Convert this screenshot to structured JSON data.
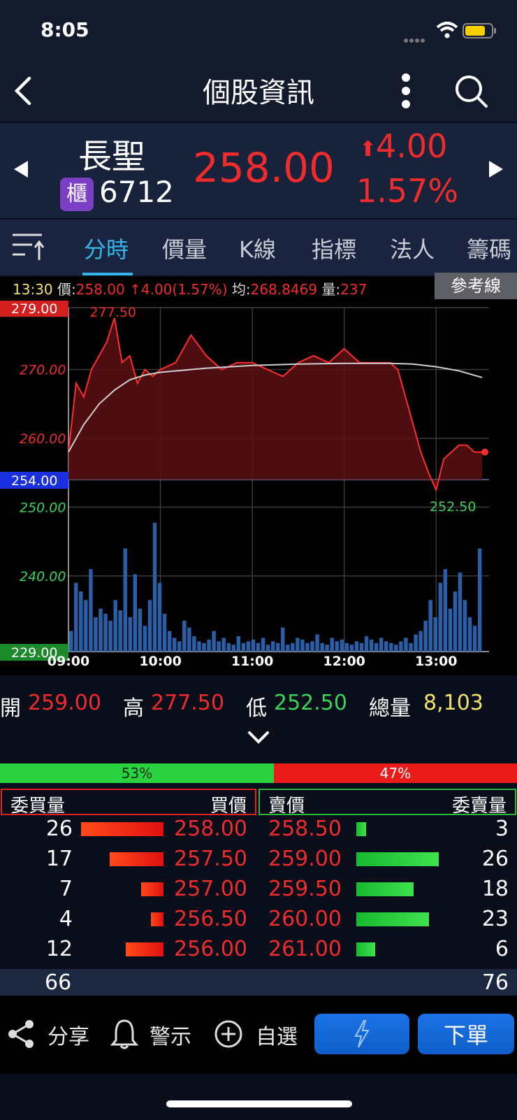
{
  "status": {
    "time": "8:05"
  },
  "header": {
    "title": "個股資訊"
  },
  "stock": {
    "name": "長聖",
    "market_badge": "櫃",
    "code": "6712",
    "price": "258.00",
    "change": "4.00",
    "change_pct": "1.57%"
  },
  "tabs": [
    {
      "label": "分時",
      "active": true
    },
    {
      "label": "價量",
      "active": false
    },
    {
      "label": "K線",
      "active": false
    },
    {
      "label": "指標",
      "active": false
    },
    {
      "label": "法人",
      "active": false
    },
    {
      "label": "籌碼",
      "active": false
    }
  ],
  "info_line": {
    "time": "13:30",
    "price_label": "價:",
    "price": "258.00",
    "change": "4.00(1.57%)",
    "avg_label": "均:",
    "avg": "268.8469",
    "vol_label": "量:",
    "vol": "237",
    "ref_button": "參考線"
  },
  "chart_data": {
    "type": "line",
    "title": "",
    "y_price_labels": [
      "279.00",
      "270.00",
      "260.00",
      "254.00",
      "250.00",
      "240.00",
      "229.00"
    ],
    "x_labels": [
      "09:00",
      "10:00",
      "11:00",
      "12:00",
      "13:00"
    ],
    "ylim": [
      229,
      279
    ],
    "reference_price": 254.0,
    "high_label": "277.50",
    "low_label": "252.50",
    "series": [
      {
        "values_time": [
          "09:00",
          "09:05",
          "09:10",
          "09:15",
          "09:20",
          "09:25",
          "09:30",
          "09:35",
          "09:40",
          "09:45",
          "09:50",
          "09:55",
          "10:00",
          "10:10",
          "10:20",
          "10:30",
          "10:40",
          "10:50",
          "11:00",
          "11:10",
          "11:20",
          "11:30",
          "11:40",
          "11:50",
          "12:00",
          "12:10",
          "12:20",
          "12:30",
          "12:35",
          "12:40",
          "12:45",
          "12:50",
          "12:55",
          "13:00",
          "13:05",
          "13:10",
          "13:15",
          "13:20",
          "13:25",
          "13:30"
        ],
        "values": [
          258,
          268,
          266,
          270,
          272,
          274,
          277.5,
          271,
          272,
          268,
          270,
          269,
          270,
          271,
          275,
          272,
          270,
          271,
          271,
          270,
          269,
          271,
          272,
          271,
          273,
          271,
          271,
          271,
          270,
          266,
          262,
          258,
          255,
          252.5,
          257,
          258,
          259,
          259,
          258,
          258
        ]
      },
      {
        "values_time": [
          "09:00",
          "09:10",
          "09:20",
          "09:30",
          "09:40",
          "09:50",
          "10:00",
          "10:30",
          "11:00",
          "11:30",
          "12:00",
          "12:30",
          "12:45",
          "13:00",
          "13:15",
          "13:30"
        ],
        "values": [
          258,
          262,
          265,
          267,
          268.5,
          269.2,
          269.6,
          270.2,
          270.6,
          270.8,
          270.9,
          270.9,
          270.8,
          270.4,
          269.8,
          268.85
        ]
      }
    ],
    "volume": [
      12,
      40,
      35,
      30,
      48,
      20,
      25,
      22,
      18,
      30,
      24,
      60,
      20,
      45,
      25,
      15,
      30,
      75,
      40,
      22,
      12,
      8,
      6,
      18,
      14,
      9,
      6,
      5,
      7,
      12,
      6,
      8,
      5,
      4,
      9,
      5,
      6,
      7,
      5,
      8,
      4,
      6,
      5,
      14,
      4,
      5,
      8,
      7,
      5,
      6,
      10,
      5,
      4,
      8,
      6,
      7,
      5,
      4,
      6,
      5,
      9,
      7,
      5,
      8,
      6,
      5,
      4,
      6,
      8,
      5,
      10,
      12,
      18,
      30,
      20,
      40,
      48,
      25,
      35,
      46,
      30,
      20,
      15,
      60
    ]
  },
  "ohlc": {
    "open_label": "開",
    "open": "259.00",
    "high_label": "高",
    "high": "277.50",
    "low_label": "低",
    "low": "252.50",
    "vol_label": "總量",
    "vol": "8,103"
  },
  "ratio": {
    "buy_pct": "53%",
    "sell_pct": "47%",
    "buy_fraction": 0.53
  },
  "orderbook": {
    "headers": {
      "bid_vol": "委買量",
      "bid_price": "買價",
      "ask_price": "賣價",
      "ask_vol": "委賣量"
    },
    "rows": [
      {
        "bid_vol": "26",
        "bid_price": "258.00",
        "ask_price": "258.50",
        "ask_vol": "3",
        "bid_bar": 26,
        "ask_bar": 3
      },
      {
        "bid_vol": "17",
        "bid_price": "257.50",
        "ask_price": "259.00",
        "ask_vol": "26",
        "bid_bar": 17,
        "ask_bar": 26
      },
      {
        "bid_vol": "7",
        "bid_price": "257.00",
        "ask_price": "259.50",
        "ask_vol": "18",
        "bid_bar": 7,
        "ask_bar": 18
      },
      {
        "bid_vol": "4",
        "bid_price": "256.50",
        "ask_price": "260.00",
        "ask_vol": "23",
        "bid_bar": 4,
        "ask_bar": 23
      },
      {
        "bid_vol": "12",
        "bid_price": "256.00",
        "ask_price": "261.00",
        "ask_vol": "6",
        "bid_bar": 12,
        "ask_bar": 6
      }
    ],
    "bid_total": "66",
    "ask_total": "76"
  },
  "bottom": {
    "share": "分享",
    "alert": "警示",
    "watch": "自選",
    "order": "下單"
  },
  "colors": {
    "up": "#ee2c2c",
    "down": "#39d35b",
    "accent": "#34b7e8"
  }
}
